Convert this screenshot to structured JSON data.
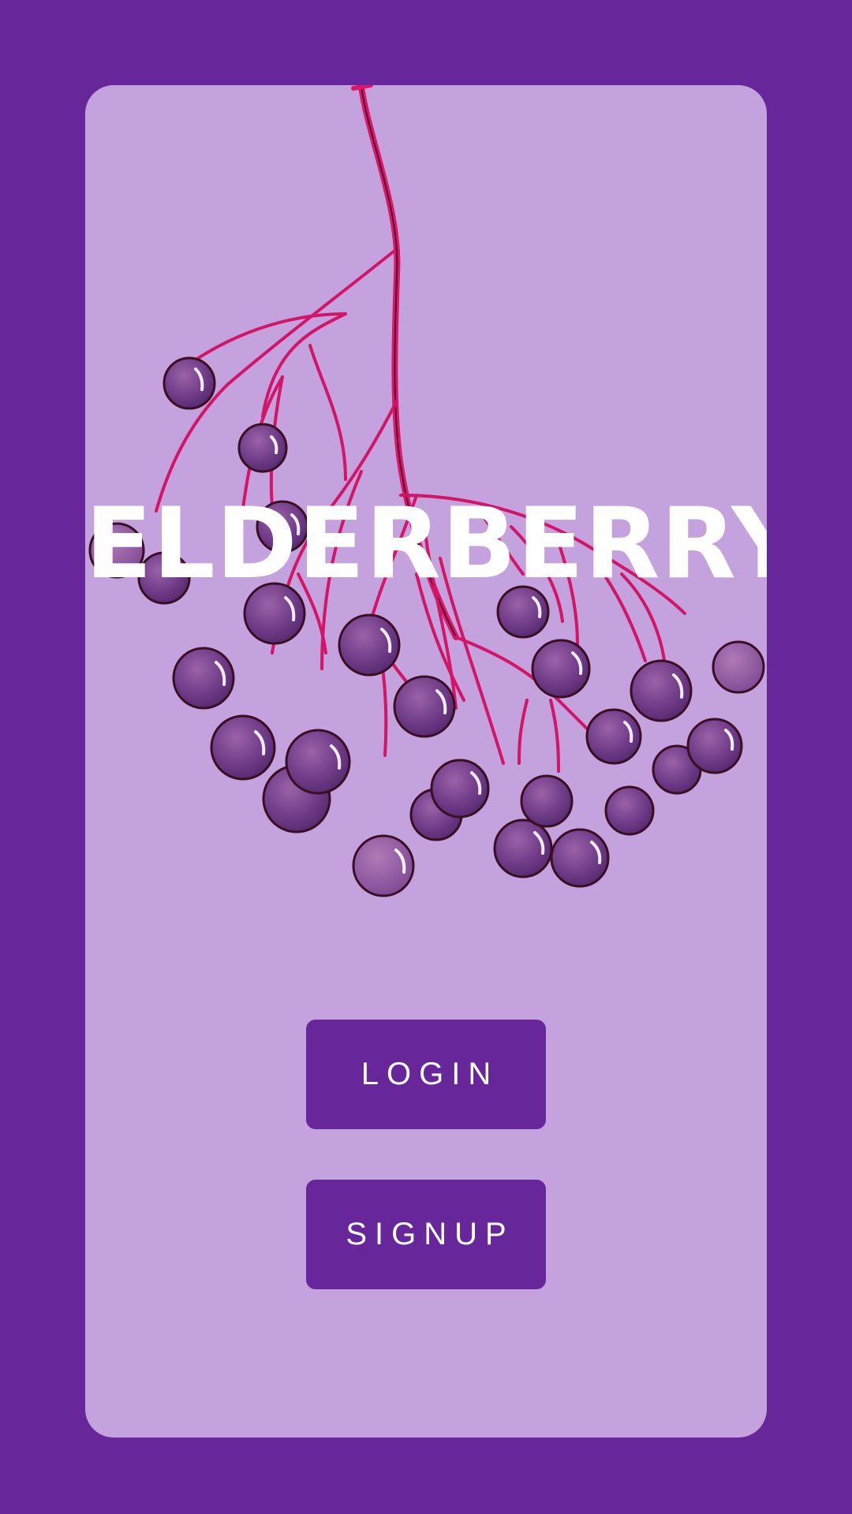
{
  "screen": {
    "background_color": "#67279a",
    "card_color": "#c3a2dd",
    "accent_color": "#67279a"
  },
  "hero": {
    "title": "ELDERBERRY",
    "illustration_icon": "elderberry-cluster-illustration"
  },
  "actions": {
    "login_label": "LOGIN",
    "signup_label": "SIGNUP"
  }
}
